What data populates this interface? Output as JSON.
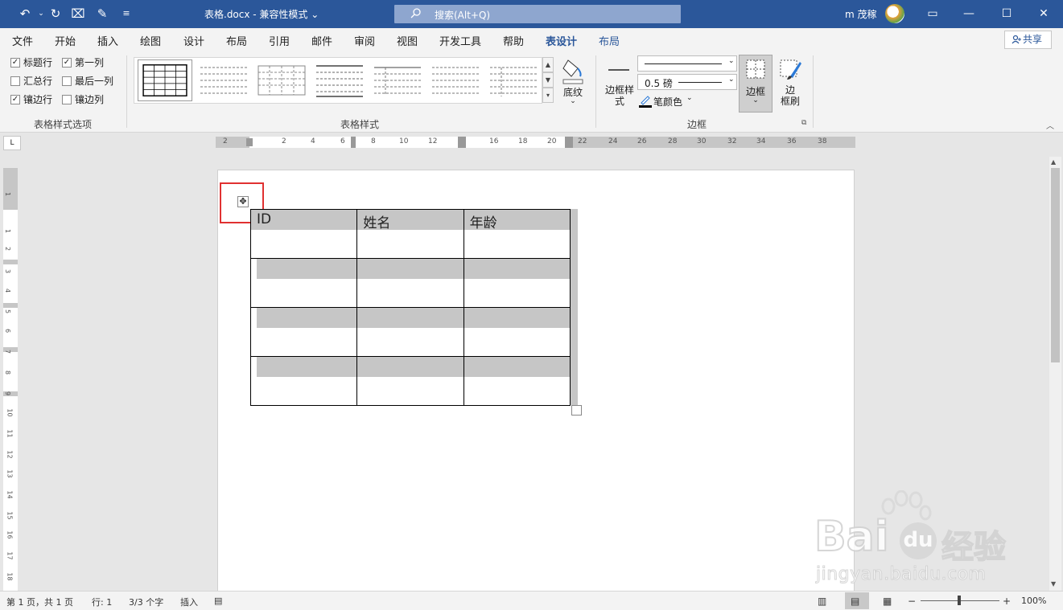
{
  "titlebar": {
    "document_title": "表格.docx  -  兼容性模式 ⌄",
    "search_placeholder": "搜索(Alt+Q)",
    "user_name": "m 茂稼",
    "accent": "#2b579a"
  },
  "tabs": [
    "文件",
    "开始",
    "插入",
    "绘图",
    "设计",
    "布局",
    "引用",
    "邮件",
    "审阅",
    "视图",
    "开发工具",
    "帮助",
    "表设计",
    "布局"
  ],
  "active_tab": "表设计",
  "share_label": "共享",
  "ribbon": {
    "style_options": {
      "header_row": "标题行",
      "first_column": "第一列",
      "total_row": "汇总行",
      "last_column": "最后一列",
      "banded_rows": "镶边行",
      "banded_columns": "镶边列",
      "group_label": "表格样式选项"
    },
    "table_styles_label": "表格样式",
    "shading_label": "底纹",
    "border_styles_label": "边框样\n式",
    "pen_weight": "0.5 磅",
    "pen_color_label": "笔颜色",
    "borders_label": "边框",
    "border_painter_label": "边\n框刷",
    "borders_group_label": "边框"
  },
  "ruler_numbers": [
    "2",
    "2",
    "4",
    "6",
    "8",
    "10",
    "12",
    "16",
    "18",
    "20",
    "22",
    "24",
    "26",
    "28",
    "30",
    "32",
    "34",
    "36",
    "38"
  ],
  "vruler_numbers": [
    "1",
    "1",
    "2",
    "3",
    "4",
    "5",
    "6",
    "7",
    "8",
    "9",
    "10",
    "11",
    "12",
    "13",
    "14",
    "15",
    "16",
    "17",
    "18"
  ],
  "table": {
    "headers": [
      "ID",
      "姓名",
      "年龄"
    ],
    "rows": 4,
    "columns": 3
  },
  "status": {
    "page": "第 1 页，共 1 页",
    "line": "行: 1",
    "words": "3/3 个字",
    "mode": "插入",
    "zoom": "100%"
  },
  "watermark": {
    "brand": "Bai",
    "suffix": "du",
    "product": "经验",
    "url": "jingyan.baidu.com"
  }
}
